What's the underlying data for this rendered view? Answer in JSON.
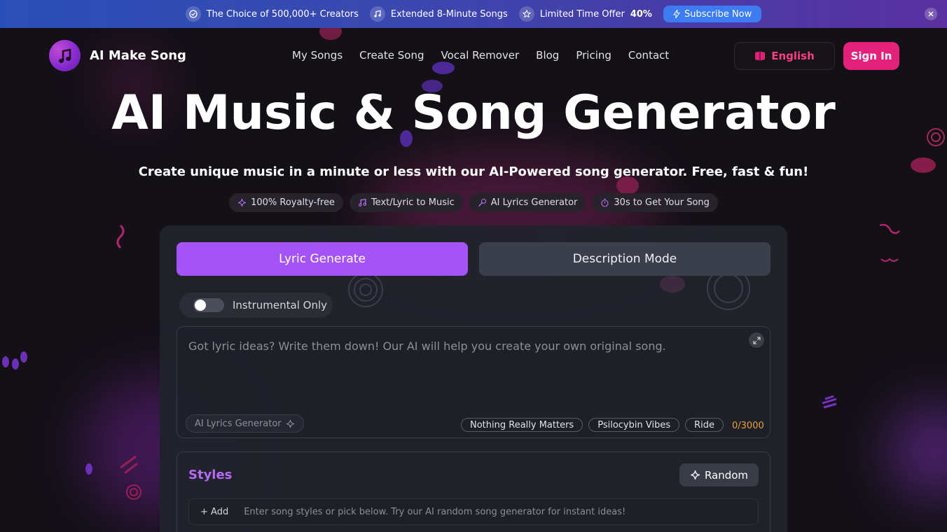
{
  "promo": {
    "item1": "The Choice of 500,000+ Creators",
    "item2": "Extended 8-Minute Songs",
    "item3_prefix": "Limited Time Offer",
    "item3_value": "40%",
    "subscribe_label": "Subscribe Now"
  },
  "header": {
    "brand": "AI Make Song",
    "nav": [
      "My Songs",
      "Create Song",
      "Vocal Remover",
      "Blog",
      "Pricing",
      "Contact"
    ],
    "language": "English",
    "signin_label": "Sign In"
  },
  "hero": {
    "title": "AI Music & Song Generator",
    "subtitle": "Create unique music in a minute or less with our AI-Powered song generator. Free, fast & fun!",
    "features": [
      "100% Royalty-free",
      "Text/Lyric to Music",
      "AI Lyrics Generator",
      "30s to Get Your Song"
    ]
  },
  "generator": {
    "tabs": [
      "Lyric Generate",
      "Description Mode"
    ],
    "active_tab": "Lyric Generate",
    "instrumental_label": "Instrumental Only",
    "instrumental_on": false,
    "lyric_placeholder": "Got lyric ideas? Write them down! Our AI will help you create your own original song.",
    "lyric_value": "",
    "ai_lyrics_button": "AI Lyrics Generator",
    "suggestions": [
      "Nothing Really Matters",
      "Psilocybin Vibes",
      "Ride"
    ],
    "counter": "0/3000",
    "styles_title": "Styles",
    "random_label": "Random",
    "add_label": "+ Add",
    "styles_placeholder": "Enter song styles or pick below. Try our AI random song generator for instant ideas!"
  },
  "colors": {
    "accent_purple": "#a453f7",
    "brand_pink": "#e3207a",
    "counter_orange": "#e8a23c",
    "promo_blue": "#3d7bf0"
  }
}
